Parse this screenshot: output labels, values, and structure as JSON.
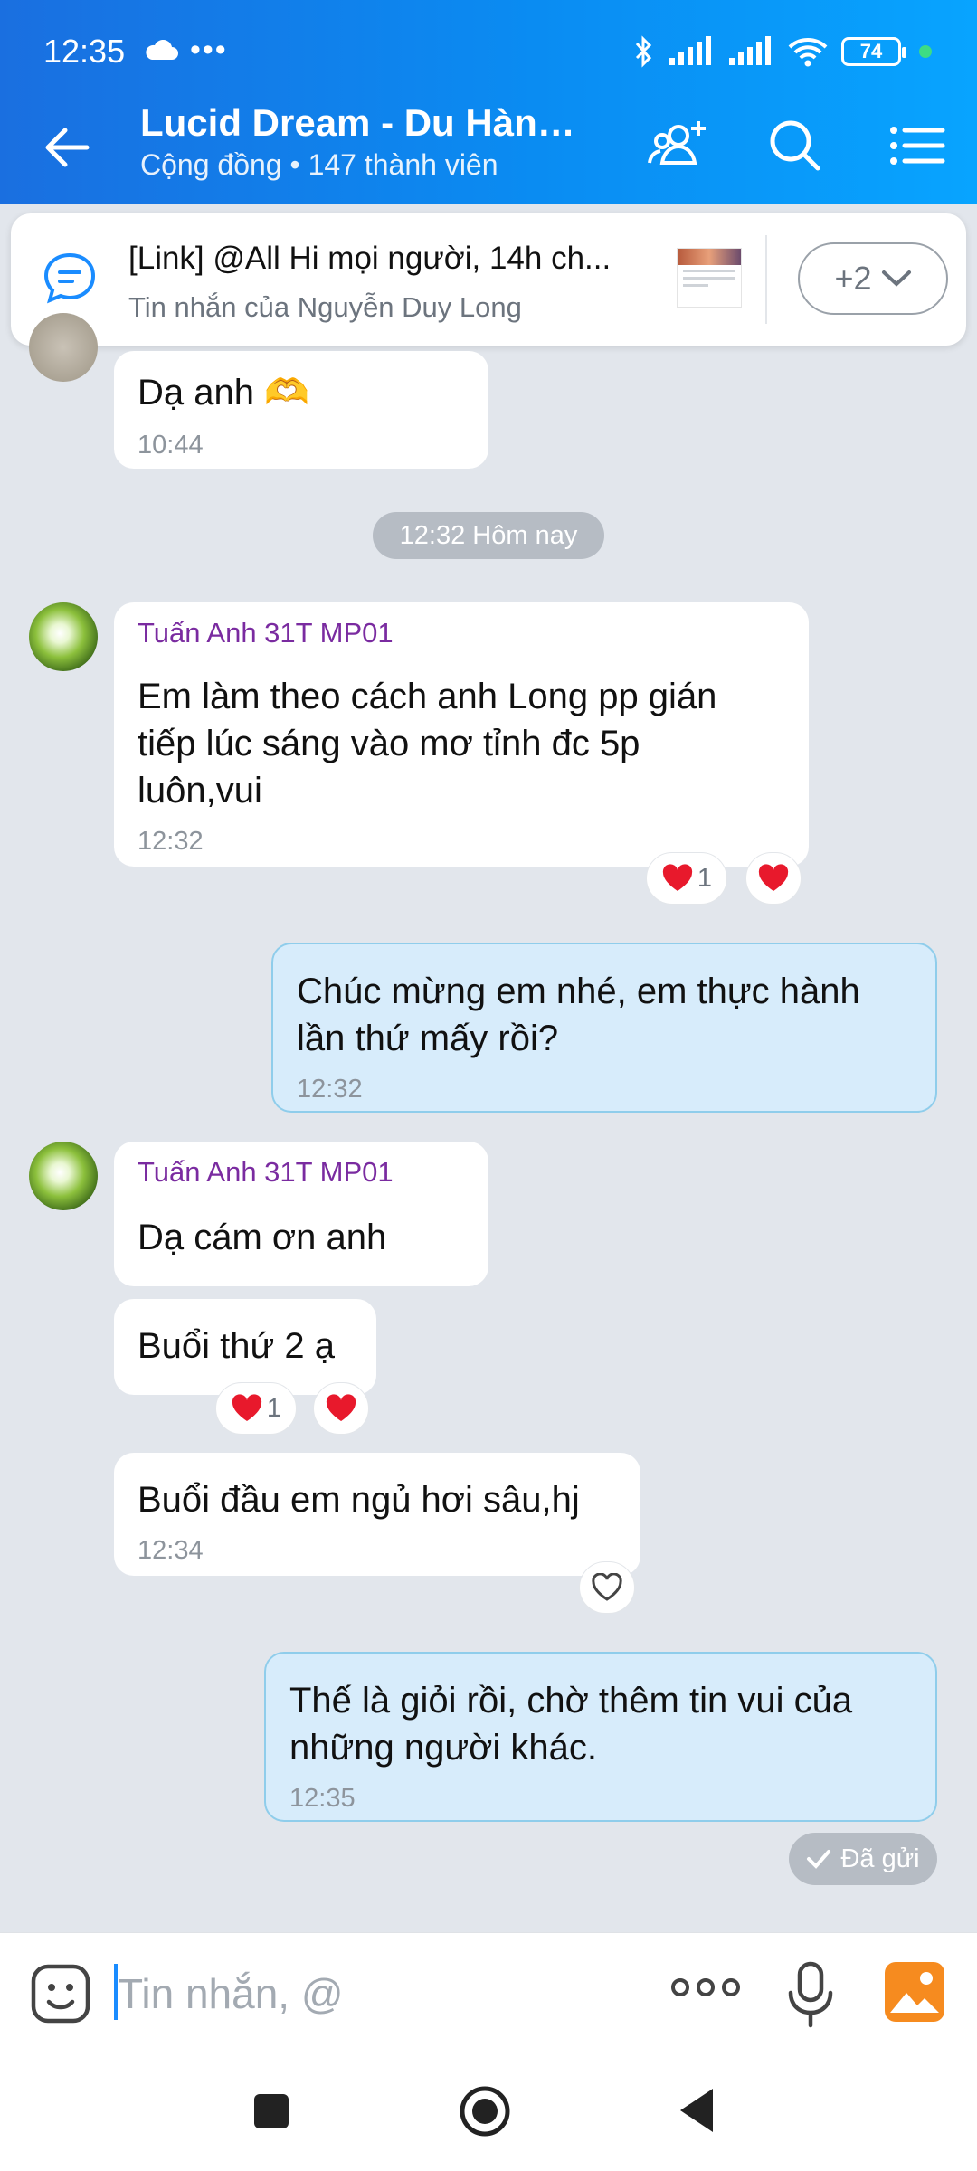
{
  "status_bar": {
    "time": "12:35",
    "dots": "•••",
    "battery": "74"
  },
  "header": {
    "title": "Lucid Dream - Du Hành...",
    "subtitle": "Cộng đồng • 147 thành viên"
  },
  "pinned": {
    "title": "[Link] @All  Hi mọi người, 14h ch...",
    "subtitle": "Tin nhắn của Nguyễn Duy Long",
    "more_label": "+2"
  },
  "messages": {
    "m0": {
      "text": "Dạ anh 🫶",
      "time": "10:44"
    },
    "date_separator": "12:32 Hôm nay",
    "m1": {
      "sender": "Tuấn Anh 31T MP01",
      "line1": "Em làm theo cách anh Long pp gián",
      "line2": "tiếp lúc sáng vào mơ tỉnh đc 5p",
      "line3": "luôn,vui",
      "time": "12:32",
      "reaction_count": "1"
    },
    "m2": {
      "line1": "Chúc mừng em nhé, em thực hành",
      "line2": "lần thứ mấy rồi?",
      "time": "12:32"
    },
    "m3": {
      "sender": "Tuấn Anh 31T MP01",
      "text": "Dạ cám ơn anh"
    },
    "m4": {
      "text": "Buổi thứ 2 ạ",
      "reaction_count": "1"
    },
    "m5": {
      "text": "Buổi đầu em ngủ hơi sâu,hj",
      "time": "12:34"
    },
    "m6": {
      "line1": "Thế là giỏi rồi, chờ thêm tin vui của",
      "line2": "những người khác.",
      "time": "12:35"
    },
    "sent_status": "Đã gửi"
  },
  "composer": {
    "placeholder": "Tin nhắn, @"
  },
  "colors": {
    "accent": "#0a8cf2",
    "sender": "#7a2ba0",
    "my_bubble": "#d7ecfb",
    "heart": "#e8192c"
  }
}
